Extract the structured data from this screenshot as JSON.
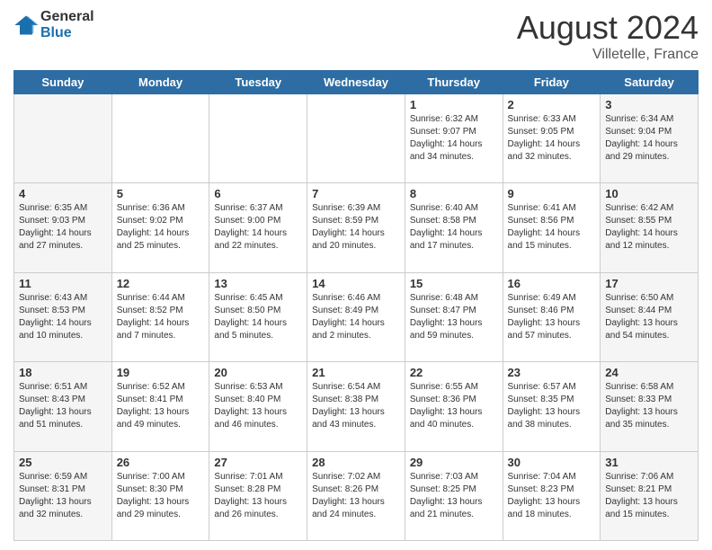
{
  "header": {
    "logo_general": "General",
    "logo_blue": "Blue",
    "month": "August 2024",
    "location": "Villetelle, France"
  },
  "weekdays": [
    "Sunday",
    "Monday",
    "Tuesday",
    "Wednesday",
    "Thursday",
    "Friday",
    "Saturday"
  ],
  "weeks": [
    [
      {
        "day": "",
        "info": ""
      },
      {
        "day": "",
        "info": ""
      },
      {
        "day": "",
        "info": ""
      },
      {
        "day": "",
        "info": ""
      },
      {
        "day": "1",
        "info": "Sunrise: 6:32 AM\nSunset: 9:07 PM\nDaylight: 14 hours\nand 34 minutes."
      },
      {
        "day": "2",
        "info": "Sunrise: 6:33 AM\nSunset: 9:05 PM\nDaylight: 14 hours\nand 32 minutes."
      },
      {
        "day": "3",
        "info": "Sunrise: 6:34 AM\nSunset: 9:04 PM\nDaylight: 14 hours\nand 29 minutes."
      }
    ],
    [
      {
        "day": "4",
        "info": "Sunrise: 6:35 AM\nSunset: 9:03 PM\nDaylight: 14 hours\nand 27 minutes."
      },
      {
        "day": "5",
        "info": "Sunrise: 6:36 AM\nSunset: 9:02 PM\nDaylight: 14 hours\nand 25 minutes."
      },
      {
        "day": "6",
        "info": "Sunrise: 6:37 AM\nSunset: 9:00 PM\nDaylight: 14 hours\nand 22 minutes."
      },
      {
        "day": "7",
        "info": "Sunrise: 6:39 AM\nSunset: 8:59 PM\nDaylight: 14 hours\nand 20 minutes."
      },
      {
        "day": "8",
        "info": "Sunrise: 6:40 AM\nSunset: 8:58 PM\nDaylight: 14 hours\nand 17 minutes."
      },
      {
        "day": "9",
        "info": "Sunrise: 6:41 AM\nSunset: 8:56 PM\nDaylight: 14 hours\nand 15 minutes."
      },
      {
        "day": "10",
        "info": "Sunrise: 6:42 AM\nSunset: 8:55 PM\nDaylight: 14 hours\nand 12 minutes."
      }
    ],
    [
      {
        "day": "11",
        "info": "Sunrise: 6:43 AM\nSunset: 8:53 PM\nDaylight: 14 hours\nand 10 minutes."
      },
      {
        "day": "12",
        "info": "Sunrise: 6:44 AM\nSunset: 8:52 PM\nDaylight: 14 hours\nand 7 minutes."
      },
      {
        "day": "13",
        "info": "Sunrise: 6:45 AM\nSunset: 8:50 PM\nDaylight: 14 hours\nand 5 minutes."
      },
      {
        "day": "14",
        "info": "Sunrise: 6:46 AM\nSunset: 8:49 PM\nDaylight: 14 hours\nand 2 minutes."
      },
      {
        "day": "15",
        "info": "Sunrise: 6:48 AM\nSunset: 8:47 PM\nDaylight: 13 hours\nand 59 minutes."
      },
      {
        "day": "16",
        "info": "Sunrise: 6:49 AM\nSunset: 8:46 PM\nDaylight: 13 hours\nand 57 minutes."
      },
      {
        "day": "17",
        "info": "Sunrise: 6:50 AM\nSunset: 8:44 PM\nDaylight: 13 hours\nand 54 minutes."
      }
    ],
    [
      {
        "day": "18",
        "info": "Sunrise: 6:51 AM\nSunset: 8:43 PM\nDaylight: 13 hours\nand 51 minutes."
      },
      {
        "day": "19",
        "info": "Sunrise: 6:52 AM\nSunset: 8:41 PM\nDaylight: 13 hours\nand 49 minutes."
      },
      {
        "day": "20",
        "info": "Sunrise: 6:53 AM\nSunset: 8:40 PM\nDaylight: 13 hours\nand 46 minutes."
      },
      {
        "day": "21",
        "info": "Sunrise: 6:54 AM\nSunset: 8:38 PM\nDaylight: 13 hours\nand 43 minutes."
      },
      {
        "day": "22",
        "info": "Sunrise: 6:55 AM\nSunset: 8:36 PM\nDaylight: 13 hours\nand 40 minutes."
      },
      {
        "day": "23",
        "info": "Sunrise: 6:57 AM\nSunset: 8:35 PM\nDaylight: 13 hours\nand 38 minutes."
      },
      {
        "day": "24",
        "info": "Sunrise: 6:58 AM\nSunset: 8:33 PM\nDaylight: 13 hours\nand 35 minutes."
      }
    ],
    [
      {
        "day": "25",
        "info": "Sunrise: 6:59 AM\nSunset: 8:31 PM\nDaylight: 13 hours\nand 32 minutes."
      },
      {
        "day": "26",
        "info": "Sunrise: 7:00 AM\nSunset: 8:30 PM\nDaylight: 13 hours\nand 29 minutes."
      },
      {
        "day": "27",
        "info": "Sunrise: 7:01 AM\nSunset: 8:28 PM\nDaylight: 13 hours\nand 26 minutes."
      },
      {
        "day": "28",
        "info": "Sunrise: 7:02 AM\nSunset: 8:26 PM\nDaylight: 13 hours\nand 24 minutes."
      },
      {
        "day": "29",
        "info": "Sunrise: 7:03 AM\nSunset: 8:25 PM\nDaylight: 13 hours\nand 21 minutes."
      },
      {
        "day": "30",
        "info": "Sunrise: 7:04 AM\nSunset: 8:23 PM\nDaylight: 13 hours\nand 18 minutes."
      },
      {
        "day": "31",
        "info": "Sunrise: 7:06 AM\nSunset: 8:21 PM\nDaylight: 13 hours\nand 15 minutes."
      }
    ]
  ]
}
